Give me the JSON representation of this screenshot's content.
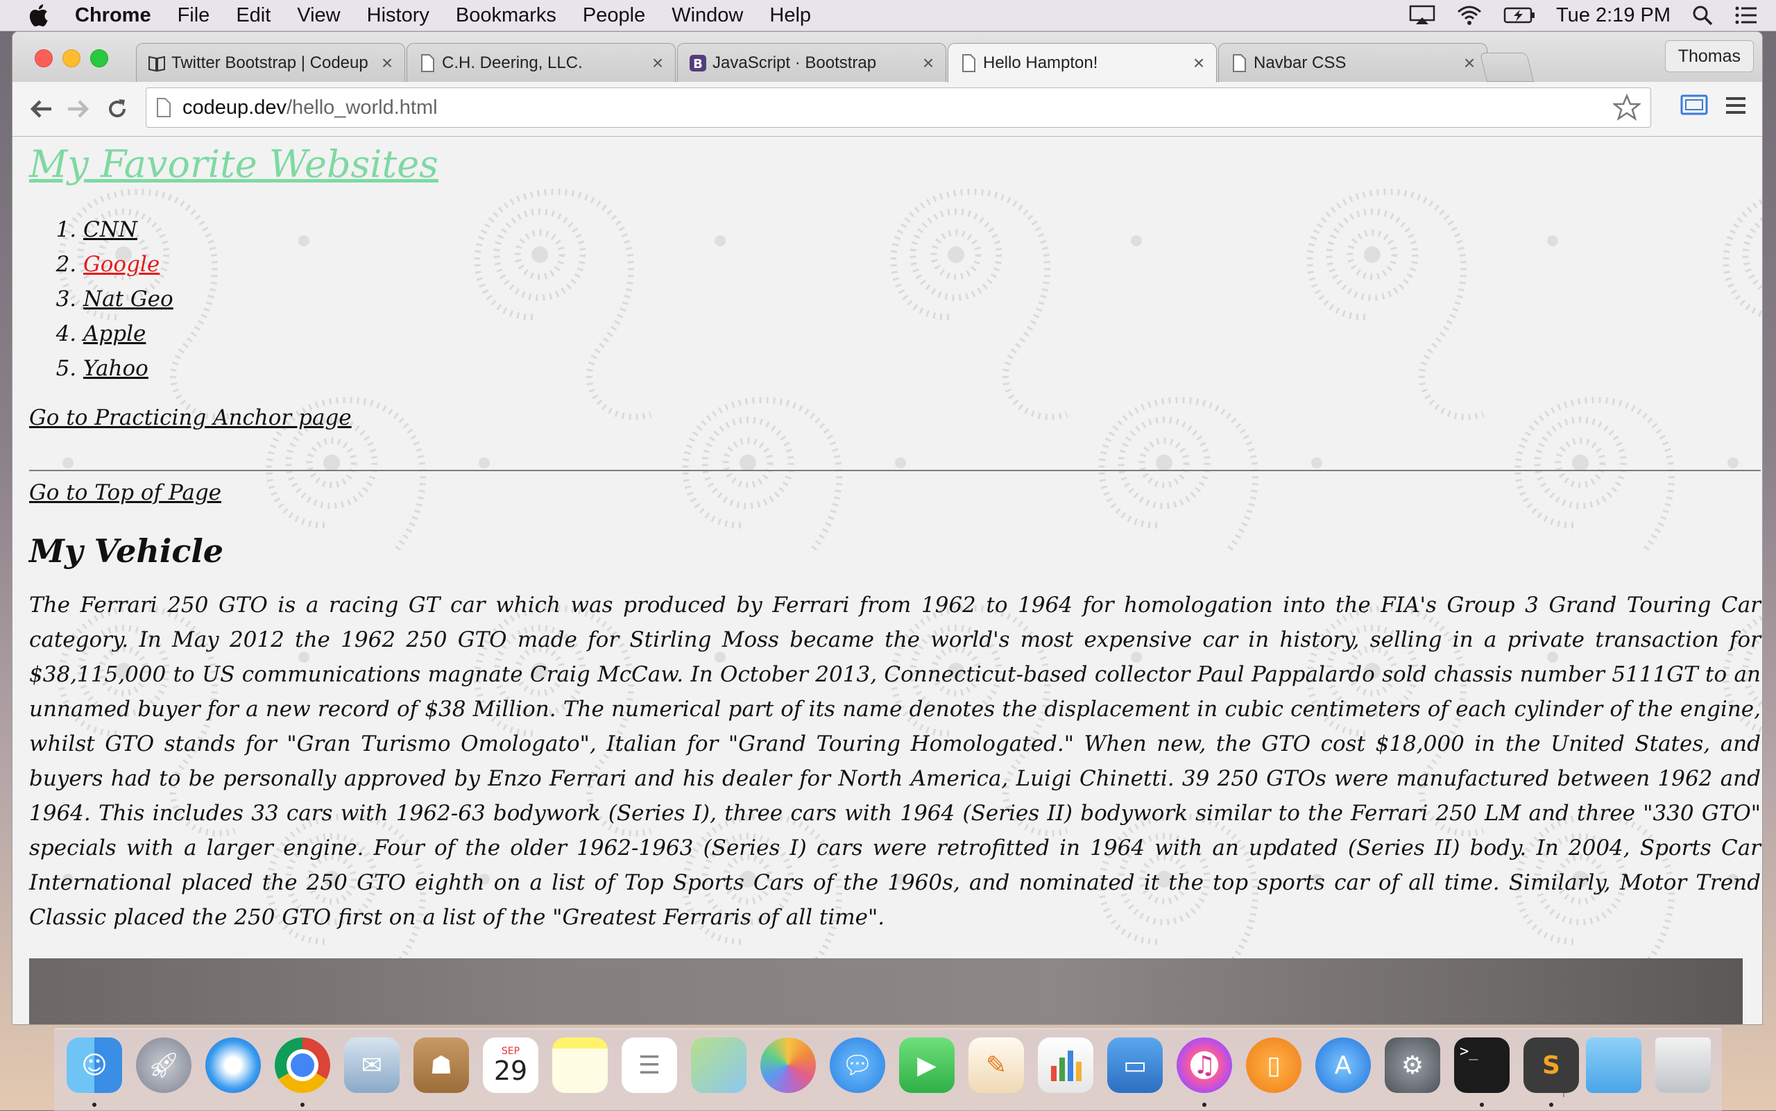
{
  "menubar": {
    "app_name": "Chrome",
    "items": [
      "File",
      "Edit",
      "View",
      "History",
      "Bookmarks",
      "People",
      "Window",
      "Help"
    ],
    "clock": "Tue 2:19 PM"
  },
  "browser": {
    "tabs": [
      {
        "title": "Twitter Bootstrap | Codeup",
        "icon": "book-icon",
        "active": false
      },
      {
        "title": "C.H. Deering, LLC.",
        "icon": "page-icon",
        "active": false
      },
      {
        "title": "JavaScript · Bootstrap",
        "icon": "bootstrap-b-icon",
        "active": false
      },
      {
        "title": "Hello Hampton!",
        "icon": "page-icon",
        "active": true
      },
      {
        "title": "Navbar CSS",
        "icon": "page-icon",
        "active": false
      }
    ],
    "profile_name": "Thomas",
    "url_host": "codeup.dev",
    "url_path": "/hello_world.html"
  },
  "page": {
    "title": "My Favorite Websites",
    "sites": [
      {
        "label": "CNN",
        "visited": false
      },
      {
        "label": "Google",
        "visited": true
      },
      {
        "label": "Nat Geo",
        "visited": false
      },
      {
        "label": "Apple",
        "visited": false
      },
      {
        "label": "Yahoo",
        "visited": false
      }
    ],
    "anchor_link": "Go to Practicing Anchor page",
    "top_link": "Go to Top of Page",
    "vehicle_heading": "My Vehicle",
    "vehicle_text": "The Ferrari 250 GTO is a racing GT car which was produced by Ferrari from 1962 to 1964 for homologation into the FIA's Group 3 Grand Touring Car category. In May 2012 the 1962 250 GTO made for Stirling Moss became the world's most expensive car in history, selling in a private transaction for $38,115,000 to US communications magnate Craig McCaw. In October 2013, Connecticut-based collector Paul Pappalardo sold chassis number 5111GT to an unnamed buyer for a new record of $38 Million. The numerical part of its name denotes the displacement in cubic centimeters of each cylinder of the engine, whilst GTO stands for \"Gran Turismo Omologato\", Italian for \"Grand Touring Homologated.\" When new, the GTO cost $18,000 in the United States, and buyers had to be personally approved by Enzo Ferrari and his dealer for North America, Luigi Chinetti. 39 250 GTOs were manufactured between 1962 and 1964. This includes 33 cars with 1962-63 bodywork (Series I), three cars with 1964 (Series II) bodywork similar to the Ferrari 250 LM and three \"330 GTO\" specials with a larger engine. Four of the older 1962-1963 (Series I) cars were retrofitted in 1964 with an updated (Series II) body. In 2004, Sports Car International placed the 250 GTO eighth on a list of Top Sports Cars of the 1960s, and nominated it the top sports car of all time. Similarly, Motor Trend Classic placed the 250 GTO first on a list of the \"Greatest Ferraris of all time\".",
    "colors": {
      "title": "#7ed9a3",
      "visited_link": "#e51b1b",
      "text": "#111111"
    }
  },
  "dock": {
    "calendar_month": "SEP",
    "calendar_day": "29",
    "apps": [
      {
        "name": "finder-icon",
        "running": true
      },
      {
        "name": "launchpad-icon",
        "running": false
      },
      {
        "name": "safari-icon",
        "running": false
      },
      {
        "name": "chrome-icon",
        "running": true
      },
      {
        "name": "mail-icon",
        "running": false
      },
      {
        "name": "contacts-icon",
        "running": false
      },
      {
        "name": "calendar-icon",
        "running": false
      },
      {
        "name": "notes-icon",
        "running": false
      },
      {
        "name": "reminders-icon",
        "running": false
      },
      {
        "name": "maps-icon",
        "running": false
      },
      {
        "name": "photos-icon",
        "running": false
      },
      {
        "name": "messages-icon",
        "running": false
      },
      {
        "name": "facetime-icon",
        "running": false
      },
      {
        "name": "pages-icon",
        "running": false
      },
      {
        "name": "numbers-icon",
        "running": false
      },
      {
        "name": "keynote-icon",
        "running": false
      },
      {
        "name": "itunes-icon",
        "running": true
      },
      {
        "name": "ibooks-icon",
        "running": false
      },
      {
        "name": "app-store-icon",
        "running": false
      },
      {
        "name": "system-preferences-icon",
        "running": false
      },
      {
        "name": "terminal-icon",
        "running": true
      },
      {
        "name": "sublime-text-icon",
        "running": true
      },
      {
        "name": "downloads-folder-icon",
        "running": false
      },
      {
        "name": "trash-icon",
        "running": false
      }
    ]
  }
}
